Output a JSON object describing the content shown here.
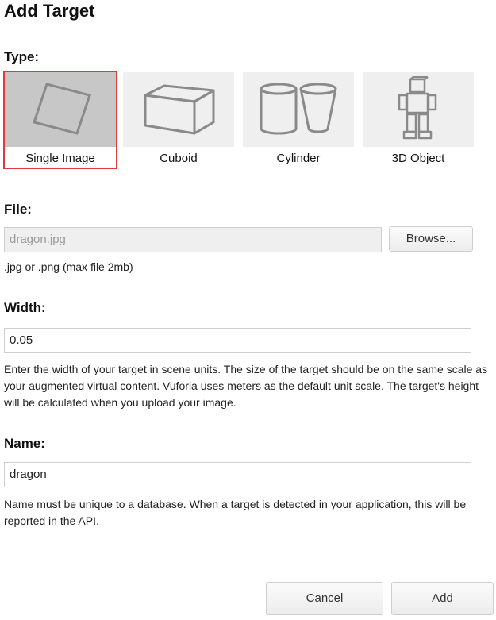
{
  "title": "Add Target",
  "type_section": {
    "label": "Type:",
    "options": [
      {
        "label": "Single Image",
        "icon": "single-image-icon",
        "selected": true
      },
      {
        "label": "Cuboid",
        "icon": "cuboid-icon",
        "selected": false
      },
      {
        "label": "Cylinder",
        "icon": "cylinder-icon",
        "selected": false
      },
      {
        "label": "3D Object",
        "icon": "3d-object-icon",
        "selected": false
      }
    ]
  },
  "file_section": {
    "label": "File:",
    "value": "dragon.jpg",
    "browse_label": "Browse...",
    "help": ".jpg or .png (max file 2mb)"
  },
  "width_section": {
    "label": "Width:",
    "value": "0.05",
    "help": "Enter the width of your target in scene units. The size of the target should be on the same scale as your augmented virtual content. Vuforia uses meters as the default unit scale. The target's height will be calculated when you upload your image."
  },
  "name_section": {
    "label": "Name:",
    "value": "dragon",
    "help": "Name must be unique to a database. When a target is detected in your application, this will be reported in the API."
  },
  "actions": {
    "cancel_label": "Cancel",
    "add_label": "Add"
  },
  "colors": {
    "selected_outline": "#e2393c",
    "selected_tile_bg": "#c7c7c7",
    "tile_bg": "#efefef"
  }
}
